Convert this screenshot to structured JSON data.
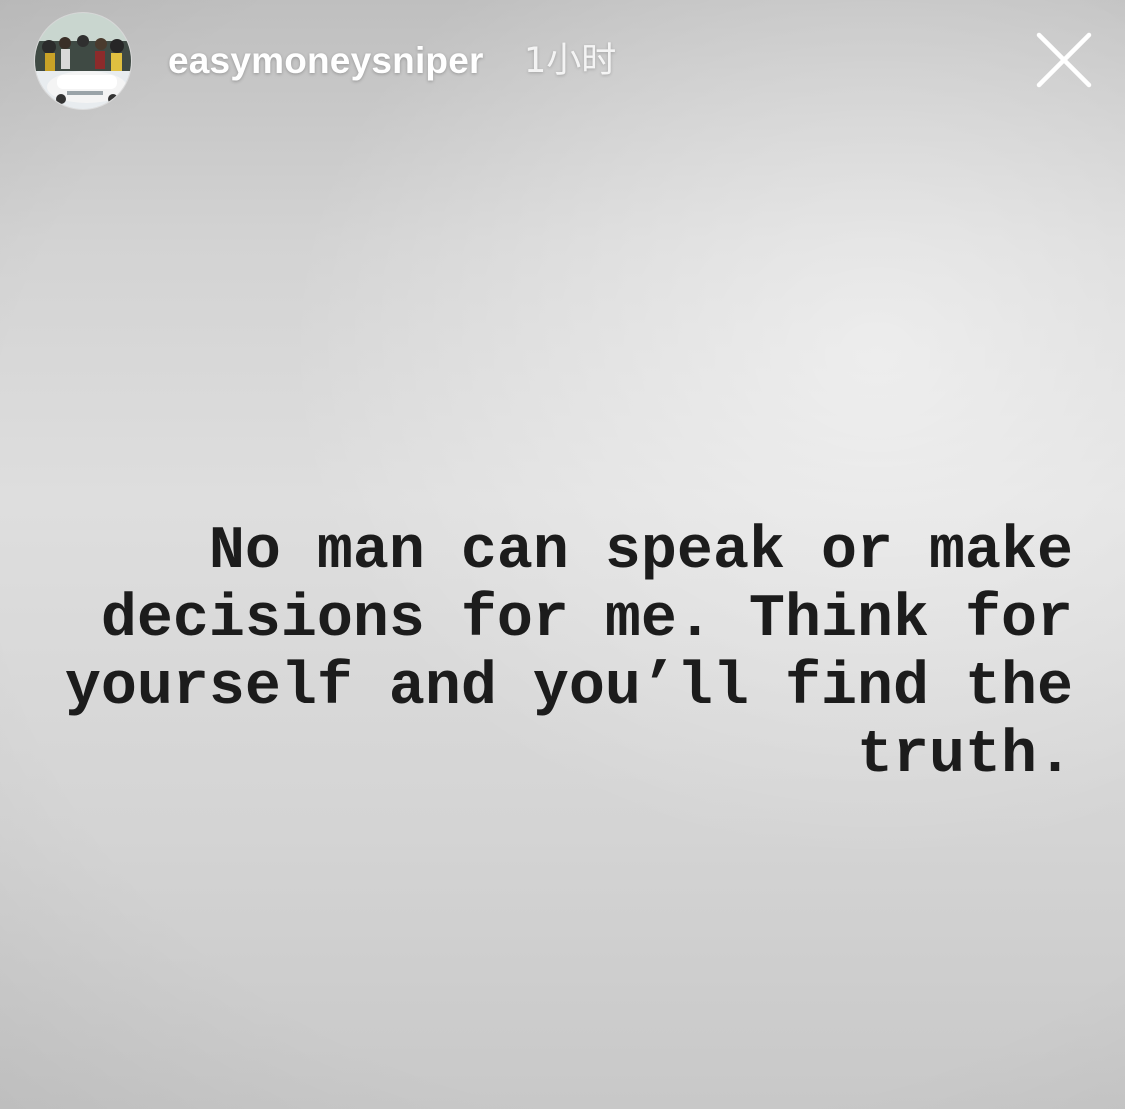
{
  "story": {
    "username": "easymoneysniper",
    "timestamp": "1小时",
    "close_icon": "close-icon",
    "avatar_icon": "profile-avatar",
    "quote_lines": [
      "No man can speak or make",
      "decisions for me. Think for",
      "yourself and you’ll find the",
      "truth."
    ]
  },
  "colors": {
    "text_dark": "#1c1c1c",
    "header_text": "#ffffff",
    "background": "#d3d3d3"
  }
}
